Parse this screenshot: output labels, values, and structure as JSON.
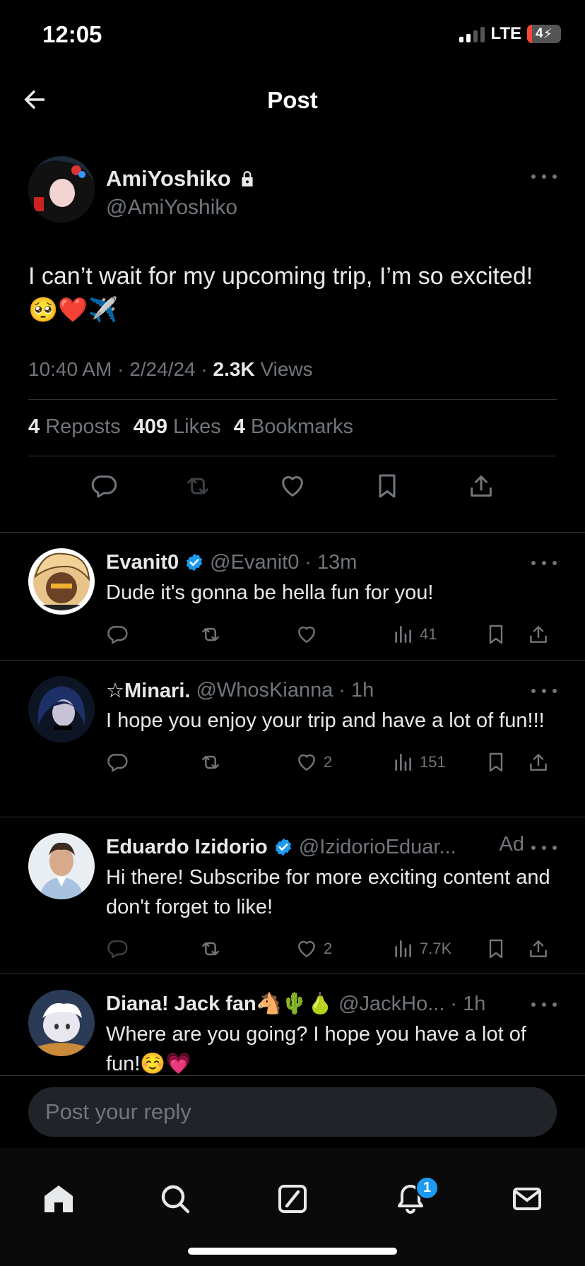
{
  "status_bar": {
    "time": "12:05",
    "network": "LTE",
    "battery": "4",
    "battery_level_percent": 4
  },
  "header": {
    "title": "Post"
  },
  "post": {
    "display_name": "AmiYoshiko",
    "handle": "@AmiYoshiko",
    "text": "I can’t wait for my upcoming trip, I’m so excited!🥺❤️✈️",
    "time": "10:40 AM",
    "date": "2/24/24",
    "views_count": "2.3K",
    "views_label": "Views",
    "reposts_count": "4",
    "reposts_label": "Reposts",
    "likes_count": "409",
    "likes_label": "Likes",
    "bookmarks_count": "4",
    "bookmarks_label": "Bookmarks"
  },
  "replies": [
    {
      "name": "Evanit0",
      "handle": "@Evanit0",
      "time": "13m",
      "text": "Dude it's gonna be hella fun for you!",
      "likes": "",
      "views": "41",
      "verified": true
    },
    {
      "name": "☆Minari.",
      "handle": "@WhosKianna",
      "time": "1h",
      "text": "I hope you enjoy your trip and have a lot of fun!!!",
      "likes": "2",
      "views": "151",
      "verified": false
    },
    {
      "name": "Eduardo Izidorio",
      "handle": "@IzidorioEduar...",
      "time": "",
      "ad_label": "Ad",
      "text": "Hi there! Subscribe for more exciting content and don't forget to like!",
      "likes": "2",
      "views": "7.7K",
      "verified": true
    },
    {
      "name": "Diana! Jack fan🐴🌵🍐",
      "handle": "@JackHo...",
      "time": "1h",
      "text": "Where are you going? I hope you have a lot of fun!☺️💗",
      "likes": "",
      "views": "",
      "verified": false
    }
  ],
  "composer": {
    "placeholder": "Post your reply"
  },
  "tabbar": {
    "notifications_badge": "1"
  },
  "colors": {
    "background": "#000000",
    "text": "#e7e9ea",
    "muted": "#71767b",
    "accent": "#1d9bf0",
    "divider": "#2f3336",
    "battery_low": "#ff453a"
  }
}
